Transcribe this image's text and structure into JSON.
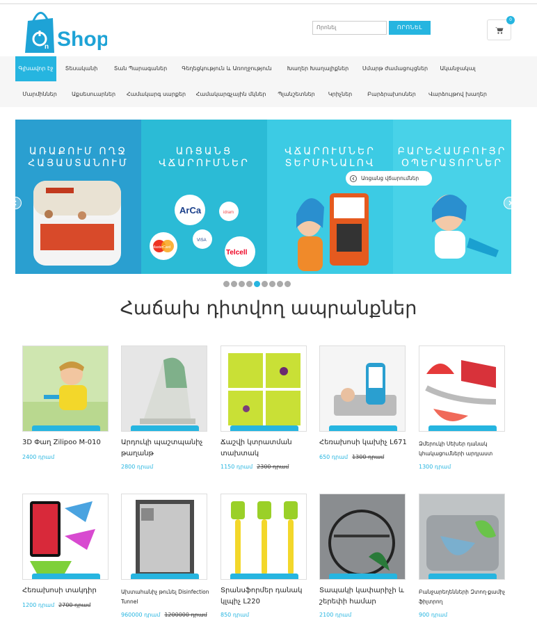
{
  "header": {
    "logo_text": "Shop",
    "search_placeholder": "Որոնել",
    "search_button": "ՈՐՈՆԵԼ",
    "cart_count": "0"
  },
  "nav": {
    "row1": [
      "Գլխավոր էջ",
      "Տեսականի",
      "Տան Պարագաներ",
      "Գեղեցկություն և Առողջություն",
      "Խաղեր Խաղալիքներ",
      "Սմարթ ժամացույցներ",
      "Ականջակալ"
    ],
    "row2": [
      "Մարմիններ",
      "Աքսեսուարներ",
      "Համակարգ սարքեր",
      "Համակարգչային մկներ",
      "Պլանշետներ",
      "Կրիչներ",
      "Բարձրախոսներ",
      "Վարձույթով խաղեր"
    ]
  },
  "slider": {
    "panels": [
      {
        "title": "ԱՌԱՔՈՒՄ ՈՂՋ ՀԱՅԱՍՏԱՆՈՒՄ",
        "color": "#2a9fd0"
      },
      {
        "title": "ԱՌՑԱՆՑ ՎՃԱՐՈՒՄՆԵՐ",
        "color": "#2bbbd6"
      },
      {
        "title": "ՎՃԱՐՈՒՄՆԵՐ ՏԵՐՄԻՆԱԼՈՎ",
        "color": "#3ccbe4"
      },
      {
        "title": "ԲԱՐԵՀԱՄԲՈՒՅՐ ՕՊԵՐԱՏՈՐՆԵՐ",
        "color": "#48d2e8"
      }
    ],
    "badge": "Առցանց վճարումներ",
    "card_labels": [
      "ArCa",
      "idram",
      "MasterCard",
      "VISA",
      "Telcell"
    ],
    "dots_total": 9,
    "dots_active": 5
  },
  "section_title": "Հաճախ դիտվող ապրանքներ",
  "products": [
    {
      "name": "3D Փաղ Zilipoo M-010",
      "price": "2400 դրամ",
      "old": ""
    },
    {
      "name": "Արդուկի պաշտպանիչ թաղանթ",
      "price": "2800 դրամ",
      "old": ""
    },
    {
      "name": "Ճաշվի կտրատման տախտակ",
      "price": "1150 դրամ",
      "old": "2300 դրամ"
    },
    {
      "name": "Հեռախոսի կախիչ L671",
      "price": "650 դրամ",
      "old": "1300 դրամ"
    },
    {
      "name": "Ձմերուկի Սեխեր դանակ կհակացումների արդյաստ",
      "price": "1300 դրամ",
      "old": ""
    },
    {
      "name": "Հեռախոսի տակդիր",
      "price": "1200 դրամ",
      "old": "2700 դրամ"
    },
    {
      "name": "Ախտահանիչ թունել Disinfection Tunnel",
      "price": "960000 դրամ",
      "old": "1200000 դրամ"
    },
    {
      "name": "Տրանսֆորմեր դանակ կլպիչ L220",
      "price": "850 դրամ",
      "old": ""
    },
    {
      "name": "Տապակի կափարիչի և շերեփի համար",
      "price": "2100 դրամ",
      "old": ""
    },
    {
      "name": "Բանջարեղենների Զտող-քամիչ ֆիլտրող",
      "price": "900 դրամ",
      "old": ""
    }
  ],
  "colors": {
    "accent": "#26b5e0"
  }
}
